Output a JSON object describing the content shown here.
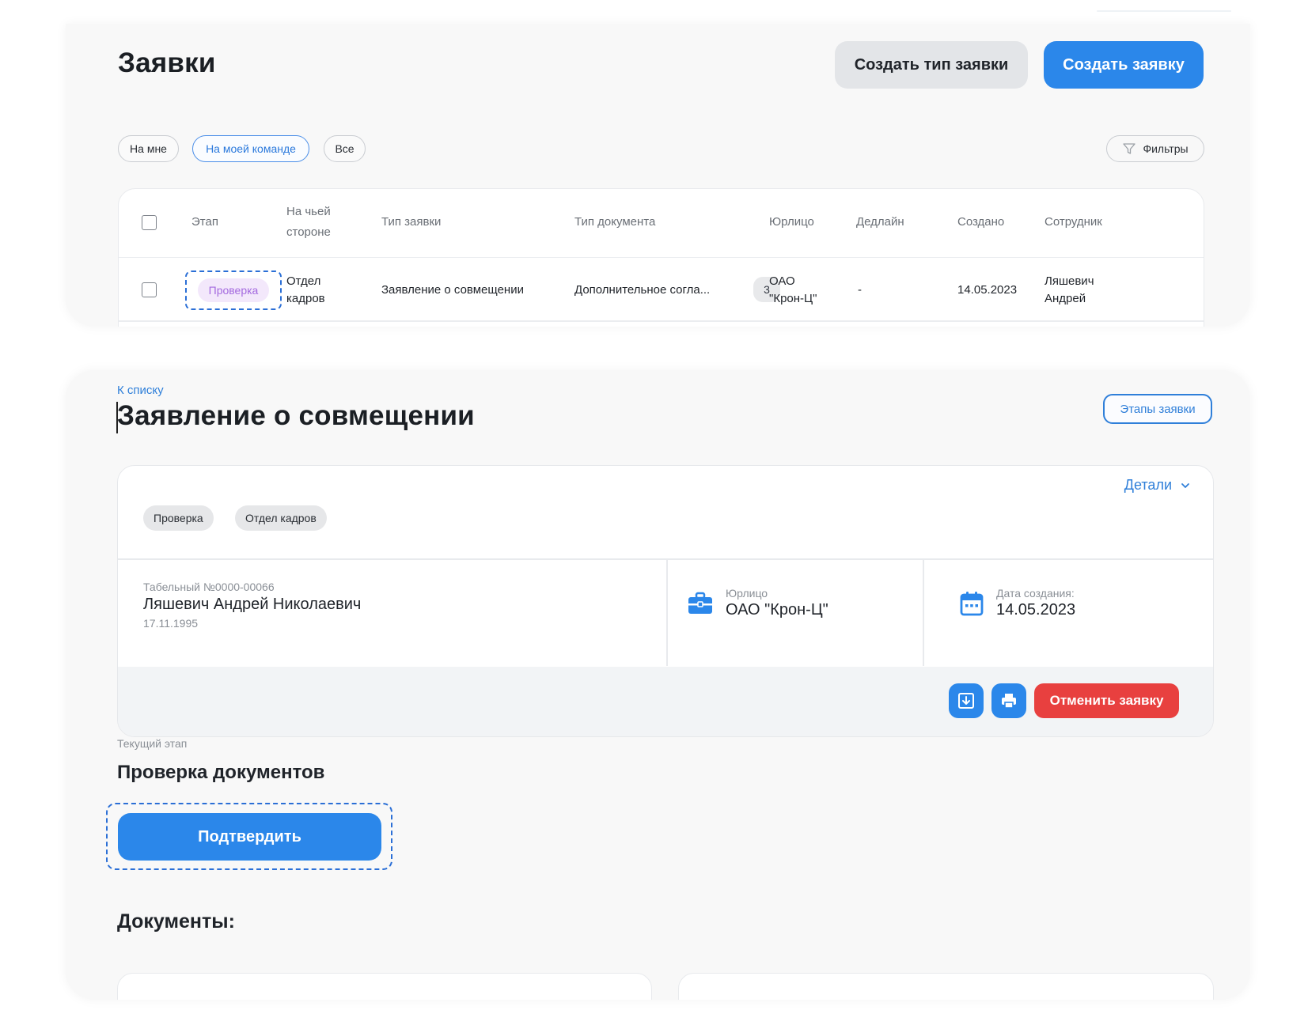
{
  "requests_list": {
    "title": "Заявки",
    "create_type_button": "Создать тип заявки",
    "create_request_button": "Создать заявку",
    "tabs": [
      "На мне",
      "На моей команде",
      "Все"
    ],
    "active_tab": "На моей команде",
    "filters_button": "Фильтры",
    "columns": {
      "stage": "Этап",
      "side_line1": "На чьей",
      "side_line2": "стороне",
      "request_type": "Тип заявки",
      "document_type": "Тип документа",
      "legal_entity": "Юрлицо",
      "deadline": "Дедлайн",
      "created": "Создано",
      "employee": "Сотрудник"
    },
    "row": {
      "stage": "Проверка",
      "side_line1": "Отдел",
      "side_line2": "кадров",
      "request_type": "Заявление о совмещении",
      "document_type": "Дополнительное согла...",
      "document_count": "3",
      "legal_entity_line1": "ОАО",
      "legal_entity_line2": "\"Крон-Ц\"",
      "deadline": "-",
      "created": "14.05.2023",
      "employee_line1": "Ляшевич",
      "employee_line2": "Андрей"
    }
  },
  "request_detail": {
    "back_link": "К списку",
    "title": "Заявление о совмещении",
    "stages_button": "Этапы заявки",
    "details_toggle": "Детали",
    "tags": [
      "Проверка",
      "Отдел кадров"
    ],
    "employee": {
      "personnel_number": "Табельный №0000-00066",
      "full_name": "Ляшевич Андрей Николаевич",
      "birth_date": "17.11.1995"
    },
    "legal_entity": {
      "label": "Юрлицо",
      "value": "ОАО \"Крон-Ц\""
    },
    "creation_date": {
      "label": "Дата создания:",
      "value": "14.05.2023"
    },
    "cancel_button": "Отменить заявку",
    "current_stage_label": "Текущий этап",
    "current_stage_name": "Проверка документов",
    "confirm_button": "Подтвердить",
    "documents_heading": "Документы:"
  },
  "icons": {
    "filter": "filter-funnel-icon",
    "chevron": "chevron-down-icon",
    "briefcase": "briefcase-icon",
    "calendar": "calendar-icon",
    "download": "download-icon",
    "print": "printer-icon"
  },
  "colors": {
    "primary": "#2b87ea",
    "danger": "#e8403f",
    "stage_tag_bg": "#f3e8fb",
    "stage_tag_text": "#a46adf",
    "highlight_dash": "#2b6fd6"
  }
}
